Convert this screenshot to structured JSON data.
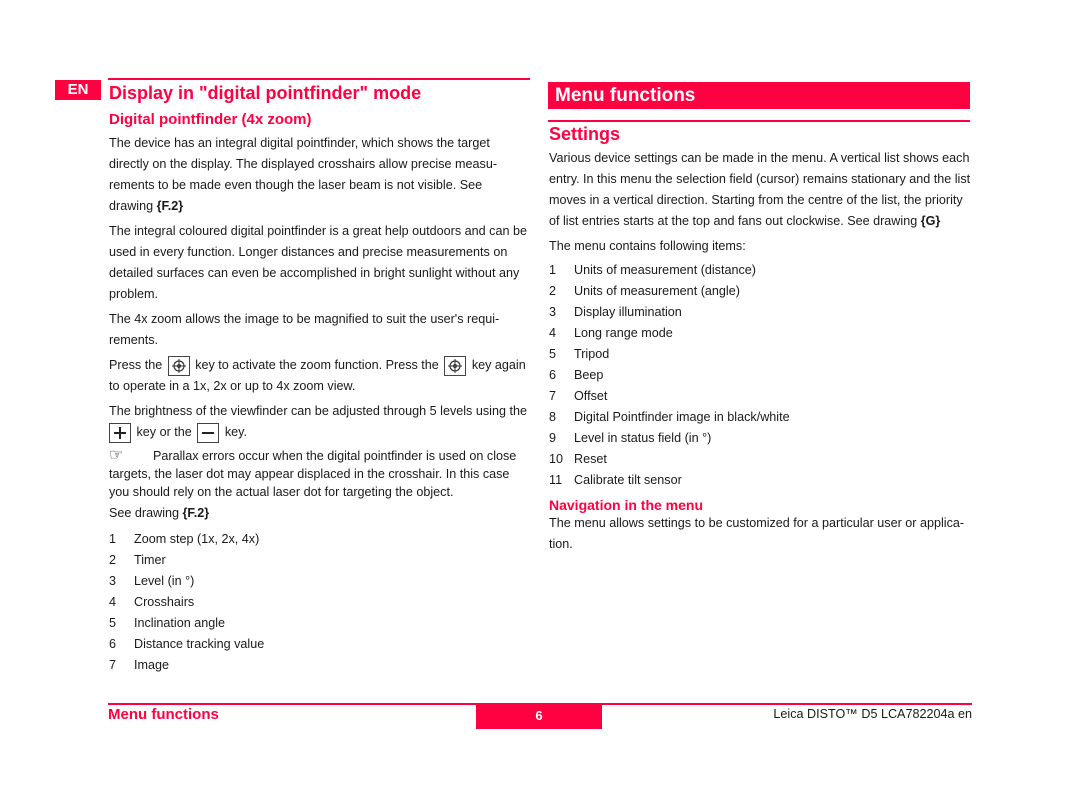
{
  "left": {
    "lang_tag": "EN",
    "heading": "Display in \"digital pointfinder\" mode",
    "subheading": "Digital pointfinder (4x zoom)",
    "para1": "The device has an integral digital pointfinder, which shows the target directly on the display. The displayed crosshairs allow precise measu-rements to be made even though the laser beam is not visible. See drawing",
    "para1_ref": "{F.2}",
    "para2": "The integral coloured digital pointfinder is a great help outdoors and can be used in every function. Longer distances and precise measurements on detailed surfaces can even be accomplished in bright sunlight without any problem.",
    "para3": "The 4x zoom allows the image to be magnified to suit the user's requi-rements.",
    "para4_a": "Press the",
    "para4_b": "key to activate the zoom function. Press the",
    "para4_c": "key again to operate in a 1x, 2x or up to 4x zoom view.",
    "para5_a": "The brightness of the viewfinder can be adjusted through 5 levels using the",
    "para5_b": "key or the",
    "para5_c": "key.",
    "note_icon": "pointing-hand-icon",
    "note": "Parallax errors occur when the digital pointfinder is used on close targets, the laser dot may appear displaced in the crosshair. In this case you should rely on the actual laser dot for targeting the object.",
    "see_drawing": "See drawing",
    "see_drawing_ref": "{F.2}",
    "items": [
      {
        "num": "1",
        "label": "Zoom step (1x, 2x, 4x)"
      },
      {
        "num": "2",
        "label": "Timer"
      },
      {
        "num": "3",
        "label": "Level (in °)"
      },
      {
        "num": "4",
        "label": "Crosshairs"
      },
      {
        "num": "5",
        "label": "Inclination angle"
      },
      {
        "num": "6",
        "label": "Distance tracking value"
      },
      {
        "num": "7",
        "label": "Image"
      }
    ]
  },
  "right": {
    "banner": "Menu functions",
    "heading": "Settings",
    "para1": "Various device settings can be made in the menu. A vertical list shows each entry. In this menu the selection field (cursor) remains stationary and the list moves in a vertical direction. Starting from the centre of the list, the priority of list entries starts at the top and fans out clockwise. See drawing",
    "para1_ref": "{G}",
    "para2": "The menu contains following items:",
    "items": [
      {
        "num": "1",
        "label": "Units of measurement (distance)"
      },
      {
        "num": "2",
        "label": "Units of measurement (angle)"
      },
      {
        "num": "3",
        "label": "Display illumination"
      },
      {
        "num": "4",
        "label": "Long range mode"
      },
      {
        "num": "5",
        "label": "Tripod"
      },
      {
        "num": "6",
        "label": "Beep"
      },
      {
        "num": "7",
        "label": "Offset"
      },
      {
        "num": "8",
        "label": "Digital Pointfinder image in black/white"
      },
      {
        "num": "9",
        "label": "Level in status field (in °)"
      },
      {
        "num": "10",
        "label": "Reset"
      },
      {
        "num": "11",
        "label": "Calibrate tilt sensor"
      }
    ],
    "nav_heading": "Navigation in the menu",
    "nav_para": "The menu allows settings to be customized for a particular user or applica-tion."
  },
  "footer": {
    "section": "Menu functions",
    "page": "6",
    "doc_id": "Leica DISTO™ D5 LCA782204a en"
  },
  "colors": {
    "accent": "#ff0040",
    "text": "#1a1a1a"
  }
}
